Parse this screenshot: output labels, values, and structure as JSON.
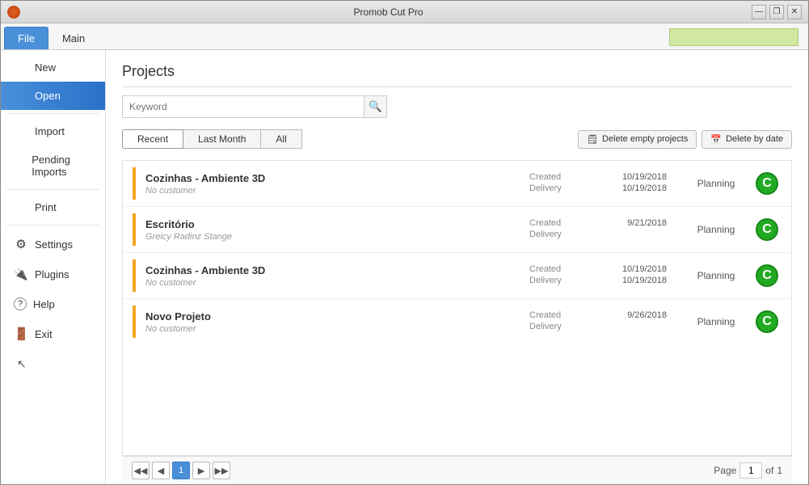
{
  "window": {
    "title": "Promob Cut Pro"
  },
  "window_controls": {
    "minimize": "—",
    "restore": "❐",
    "close": "✕"
  },
  "ribbon": {
    "tabs": [
      {
        "id": "file",
        "label": "File",
        "active": true
      },
      {
        "id": "main",
        "label": "Main",
        "active": false
      }
    ],
    "search_placeholder": ""
  },
  "sidebar": {
    "items": [
      {
        "id": "new",
        "label": "New",
        "icon": "",
        "active": false
      },
      {
        "id": "open",
        "label": "Open",
        "icon": "",
        "active": true
      },
      {
        "id": "import",
        "label": "Import",
        "icon": "",
        "active": false
      },
      {
        "id": "pending",
        "label": "Pending Imports",
        "icon": "",
        "active": false
      },
      {
        "id": "print",
        "label": "Print",
        "icon": "",
        "active": false
      },
      {
        "id": "settings",
        "label": "Settings",
        "icon": "⚙",
        "active": false
      },
      {
        "id": "plugins",
        "label": "Plugins",
        "icon": "🔧",
        "active": false
      },
      {
        "id": "help",
        "label": "Help",
        "icon": "?",
        "active": false
      },
      {
        "id": "exit",
        "label": "Exit",
        "icon": "→",
        "active": false
      }
    ]
  },
  "content": {
    "title": "Projects",
    "search": {
      "placeholder": "Keyword",
      "value": ""
    },
    "filter_tabs": [
      {
        "id": "recent",
        "label": "Recent",
        "active": true
      },
      {
        "id": "last_month",
        "label": "Last Month",
        "active": false
      },
      {
        "id": "all",
        "label": "All",
        "active": false
      }
    ],
    "action_buttons": [
      {
        "id": "delete_empty",
        "label": "Delete empty projects",
        "icon": "🗒"
      },
      {
        "id": "delete_by_date",
        "label": "Delete by date",
        "icon": "📅"
      }
    ],
    "projects": [
      {
        "name": "Cozinhas - Ambiente 3D",
        "customer": "No customer",
        "created": "10/19/2018",
        "delivery": "10/19/2018",
        "status": "Planning",
        "icon": "C"
      },
      {
        "name": "Escritório",
        "customer": "Greicy Radinz Stange",
        "created": "9/21/2018",
        "delivery": "",
        "status": "Planning",
        "icon": "C"
      },
      {
        "name": "Cozinhas - Ambiente 3D",
        "customer": "No customer",
        "created": "10/19/2018",
        "delivery": "10/19/2018",
        "status": "Planning",
        "icon": "C"
      },
      {
        "name": "Novo Projeto",
        "customer": "No customer",
        "created": "9/26/2018",
        "delivery": "",
        "status": "Planning",
        "icon": "C"
      }
    ],
    "pagination": {
      "current_page": "1",
      "total_pages": "1",
      "page_label": "Page",
      "of_label": "of"
    }
  }
}
